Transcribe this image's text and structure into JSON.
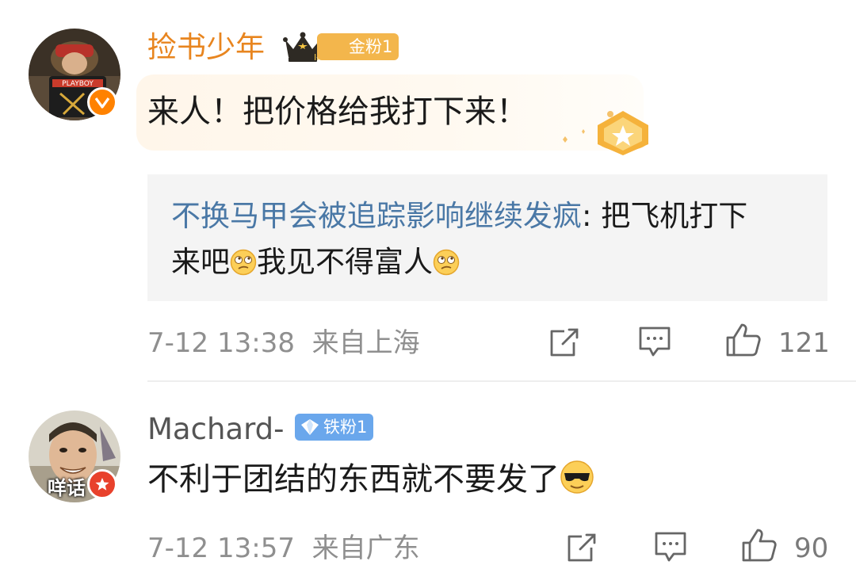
{
  "comments": [
    {
      "username": "捡书少年",
      "fan_badge": "金粉1",
      "text": "来人！把价格给我打下来！",
      "reply": {
        "user": "不换马甲会被追踪影响继续发疯",
        "line1_text": ": 把飞机打下",
        "line2_a": "来吧",
        "line2_b": "我见不得富人"
      },
      "time": "7-12 13:38",
      "location": "来自上海",
      "likes": "121"
    },
    {
      "username": "Machard-",
      "fan_badge": "铁粉1",
      "text": "不利于团结的东西就不要发了",
      "avatar_caption": "咩话",
      "time": "7-12 13:57",
      "location": "来自广东",
      "likes": "90"
    }
  ],
  "colors": {
    "gold_name": "#e8851f",
    "reply_user": "#4a78a6",
    "gold_badge": "#f3b64c",
    "iron_badge": "#6aa7ec",
    "verified_orange": "#ff8200",
    "verified_red": "#e8412c",
    "meta_gray": "#8f8f8f"
  },
  "icons": [
    "crown-icon",
    "verified-orange-icon",
    "verified-red-icon",
    "diamond-icon",
    "share-icon",
    "comment-icon",
    "like-icon",
    "thinking-emoji",
    "cool-emoji"
  ]
}
